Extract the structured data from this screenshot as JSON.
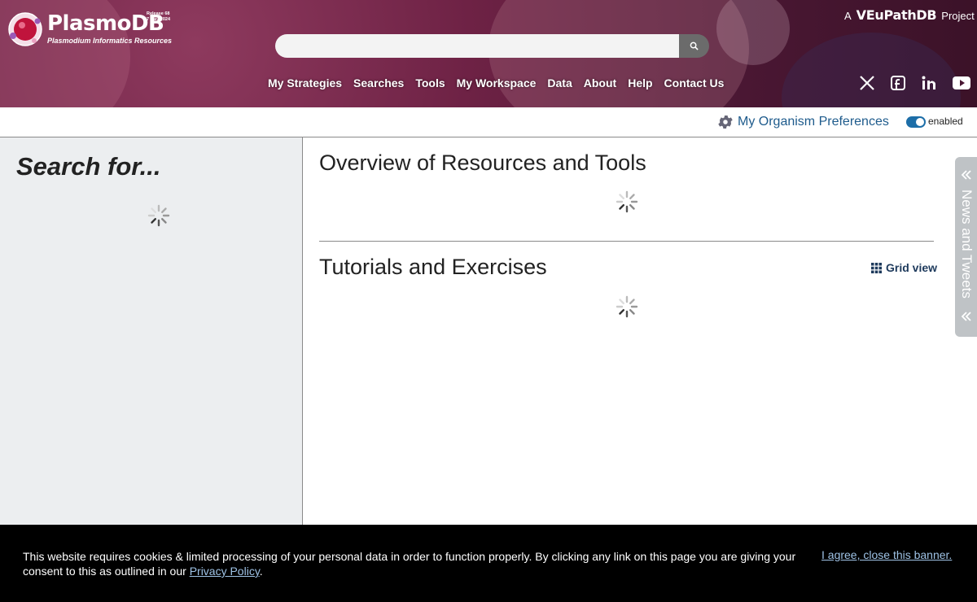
{
  "header": {
    "site_name": "PlasmoDB",
    "tagline": "Plasmodium Informatics Resources",
    "release_line1": "Release 68",
    "release_line2": "7 May 2024",
    "project_prefix": "A",
    "project_name": "VEuPathDB",
    "project_suffix": "Project",
    "search_placeholder": "",
    "search_icon": "search-icon",
    "nav": [
      "My Strategies",
      "Searches",
      "Tools",
      "My Workspace",
      "Data",
      "About",
      "Help",
      "Contact Us"
    ],
    "social": [
      "x-icon",
      "facebook-icon",
      "linkedin-icon",
      "youtube-icon"
    ]
  },
  "prefs": {
    "label": "My Organism Preferences",
    "toggle_label": "enabled"
  },
  "left": {
    "title": "Search for..."
  },
  "main": {
    "overview_title": "Overview of Resources and Tools",
    "tutorials_title": "Tutorials and Exercises",
    "grid_view": "Grid view"
  },
  "sidetab": {
    "label": "News and Tweets"
  },
  "cookie": {
    "text_before": "This website requires cookies & limited processing of your personal data in order to function properly. By clicking any link on this page you are giving your consent to this as outlined in our ",
    "link": "Privacy Policy",
    "text_after": ".",
    "agree": "I agree, close this banner."
  },
  "colors": {
    "header_bg": "#6e2245",
    "link_blue": "#1e5b8c",
    "toggle_on": "#1d6ea8",
    "panel_bg": "#eceef0",
    "cookie_bg": "#000000"
  }
}
